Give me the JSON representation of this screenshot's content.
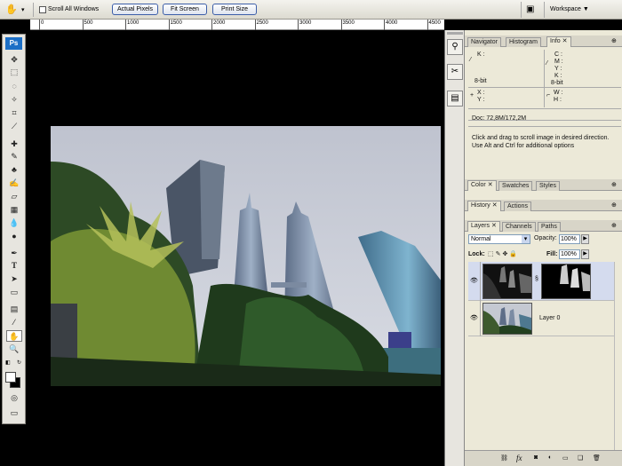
{
  "options_bar": {
    "hand_icon": "hand-icon",
    "scroll_all_windows": "Scroll All Windows",
    "actual_pixels": "Actual Pixels",
    "fit_screen": "Fit Screen",
    "print_size": "Print Size",
    "workspace": "Workspace"
  },
  "ruler": {
    "ticks": [
      "0",
      "500",
      "1000",
      "1500",
      "2000",
      "2500",
      "3000",
      "3500",
      "4000",
      "4500"
    ]
  },
  "toolbox": {
    "logo": "Ps"
  },
  "navigator_panel": {
    "tabs": [
      "Navigator",
      "Histogram",
      "Info"
    ],
    "active": "Info",
    "info": {
      "k": "K :",
      "c": "C :",
      "m": "M :",
      "y": "Y :",
      "k2": "K :",
      "bit_left": "8-bit",
      "bit_right": "8-bit",
      "x": "X :",
      "y_coord": "Y :",
      "w": "W :",
      "h": "H :",
      "doc": "Doc: 72,8M/172,2M",
      "hint": "Click and drag to scroll image in desired direction.  Use Alt and Ctrl for additional options"
    }
  },
  "color_panel": {
    "tabs": [
      "Color",
      "Swatches",
      "Styles"
    ]
  },
  "history_panel": {
    "tabs": [
      "History",
      "Actions"
    ]
  },
  "layers_panel": {
    "tabs": [
      "Layers",
      "Channels",
      "Paths"
    ],
    "blend_mode": "Normal",
    "opacity_label": "Opacity:",
    "opacity_value": "100%",
    "lock_label": "Lock:",
    "fill_label": "Fill:",
    "fill_value": "100%",
    "layers": [
      {
        "name": "",
        "has_mask": true
      },
      {
        "name": "Layer 0",
        "has_mask": false
      }
    ]
  }
}
